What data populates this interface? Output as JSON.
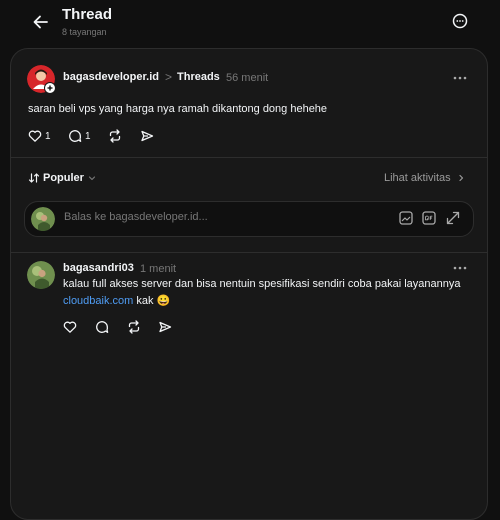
{
  "header": {
    "title": "Thread",
    "views": "8 tayangan"
  },
  "post": {
    "author": "bagasdeveloper.id",
    "separator": ">",
    "feed": "Threads",
    "time": "56 menit",
    "text": "saran beli vps yang harga nya ramah dikantong dong hehehe",
    "like_count": "1",
    "reply_count": "1"
  },
  "replies_bar": {
    "sort_label": "Populer",
    "activity_label": "Lihat aktivitas"
  },
  "reply_input": {
    "placeholder": "Balas ke bagasdeveloper.id..."
  },
  "reply": {
    "author": "bagasandri03",
    "time": "1 menit",
    "text_line1": "kalau full akses server dan bisa nentuin spesifikasi sendiri coba pakai layanannya",
    "link_text": "cloudbaik.com",
    "text_after_link": "kak",
    "emoji": "😀"
  },
  "icons": {
    "back": "arrow-left-icon",
    "more": "more-horizontal-icon",
    "like": "heart-icon",
    "comment": "comment-icon",
    "repost": "repost-icon",
    "share": "send-icon",
    "sort": "sort-arrows-icon",
    "chevron_down": "chevron-down-icon",
    "chevron_right": "chevron-right-icon",
    "image": "image-icon",
    "gif": "gif-icon",
    "expand": "expand-icon"
  },
  "colors": {
    "background": "#101010",
    "card": "#181818",
    "link": "#4f9cf3",
    "muted": "#777777"
  }
}
